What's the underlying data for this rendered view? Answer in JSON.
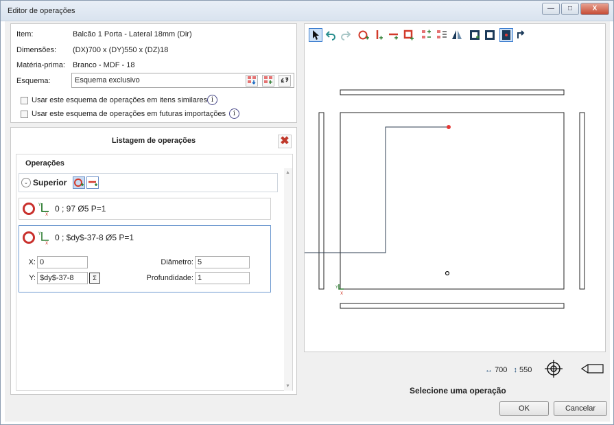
{
  "window": {
    "title": "Editor de operações",
    "buttons": [
      "minimize",
      "maximize",
      "close"
    ]
  },
  "info": {
    "item_label": "Item:",
    "item_value": "Balcão 1 Porta - Lateral 18mm (Dir)",
    "dimensions_label": "Dimensões:",
    "dimensions_value": "(DX)700 x (DY)550 x (DZ)18",
    "material_label": "Matéria-prima:",
    "material_value": "Branco - MDF - 18",
    "schema_label": "Esquema:",
    "schema_value": "Esquema exclusivo",
    "check_similar": "Usar este esquema de operações em itens similares",
    "check_future": "Usar este esquema de operações em futuras importações"
  },
  "operations": {
    "title": "Listagem de operações",
    "header": "Operações",
    "group": "Superior",
    "items": [
      {
        "text": "0 ; 97 Ø5 P=1",
        "selected": false
      },
      {
        "text": "0 ; $dy$-37-8 Ø5 P=1",
        "selected": true
      }
    ],
    "form": {
      "x_label": "X:",
      "x_value": "0",
      "y_label": "Y:",
      "y_value": "$dy$-37-8",
      "diameter_label": "Diâmetro:",
      "diameter_value": "5",
      "depth_label": "Profundidade:",
      "depth_value": "1"
    }
  },
  "canvas": {
    "dims_x": "700",
    "dims_y": "550",
    "status": "Selecione uma operação"
  },
  "buttons": {
    "ok": "OK",
    "cancel": "Cancelar"
  },
  "colors": {
    "accent": "#3f7fd0",
    "drill": "#c9302c",
    "point": "#e53935"
  }
}
